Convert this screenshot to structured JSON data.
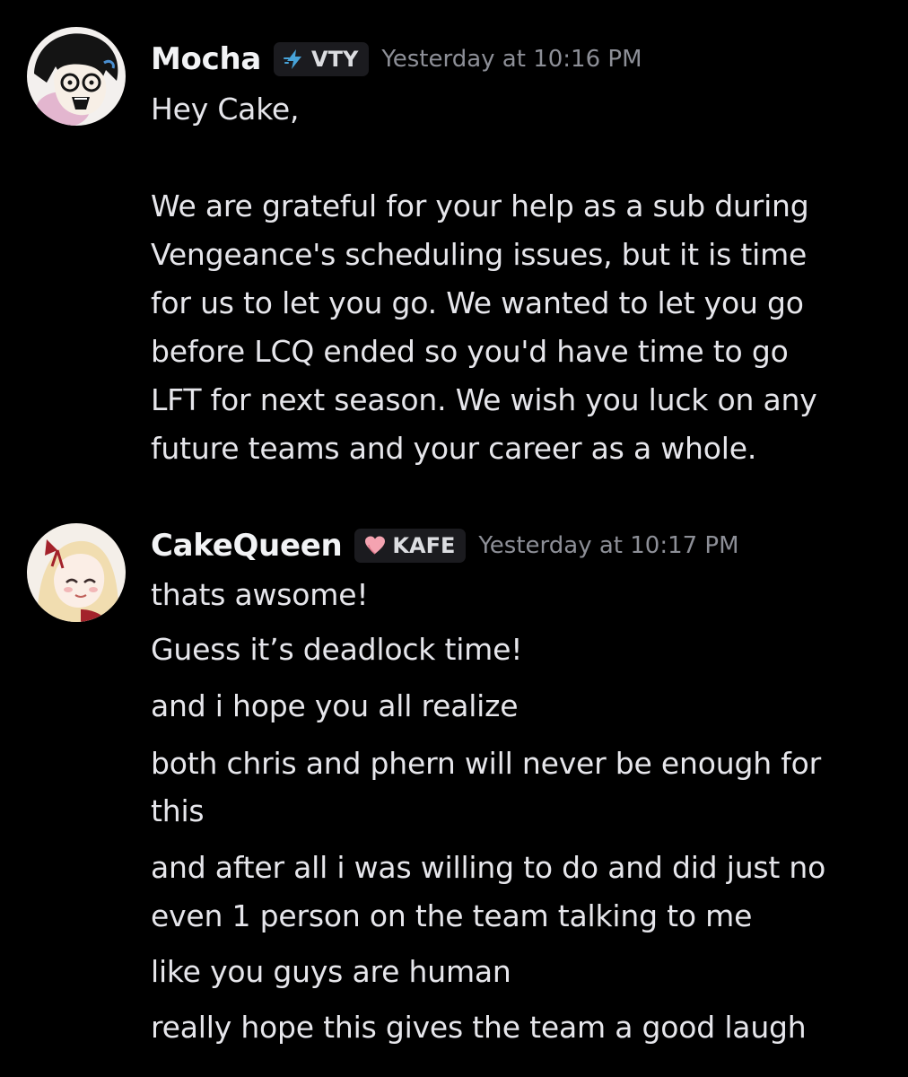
{
  "messages": [
    {
      "author": "Mocha",
      "tag": "VTY",
      "tag_icon": "lightning-bolt-icon",
      "timestamp": "Yesterday at 10:16 PM",
      "avatar": "mocha-avatar",
      "lines": [
        "Hey Cake,",
        "",
        "We are grateful for your help as a sub during",
        "Vengeance's scheduling issues, but it is time",
        "for us to let you go. We wanted to let you go",
        "before LCQ ended so you'd have time to go",
        "LFT for next season. We wish you luck on any",
        "future teams and your career as a whole."
      ]
    },
    {
      "author": "CakeQueen",
      "tag": "KAFE",
      "tag_icon": "heart-icon",
      "timestamp": "Yesterday at 10:17 PM",
      "avatar": "cakequeen-avatar",
      "lines": [
        "thats awsome!",
        "Guess it’s deadlock time!",
        "and i hope you all realize",
        "both chris and phern will never be enough for",
        "this",
        "and after all i was willing to do and did just no",
        "even 1 person on the team talking to me",
        "like you guys are human",
        "really hope this gives the team a good laugh"
      ]
    }
  ],
  "colors": {
    "background": "#000000",
    "username": "#f2f3f5",
    "timestamp": "#8d8f97",
    "tag_background": "#1b1b1f",
    "bolt": "#47a3d9",
    "heart": "#f4a3b1"
  }
}
